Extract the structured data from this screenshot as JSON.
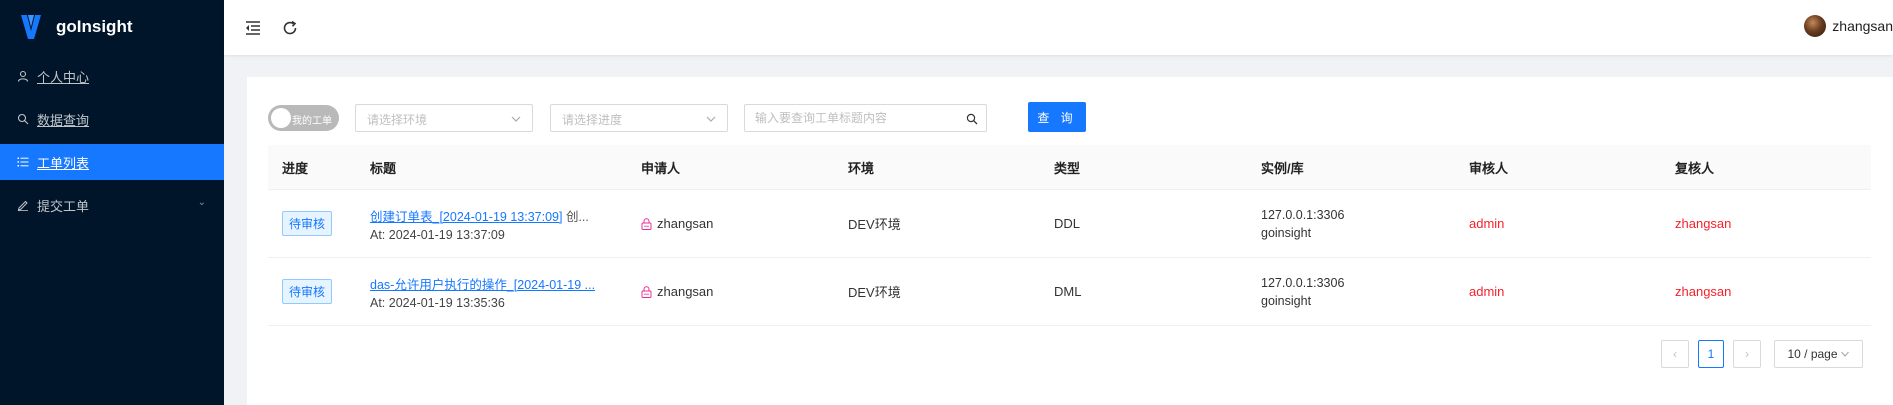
{
  "app": {
    "name": "goInsight",
    "brand_color": "#1677ff",
    "sidebar_bg": "#001529"
  },
  "sidebar": {
    "items": [
      {
        "label": "个人中心",
        "icon": "user-icon"
      },
      {
        "label": "数据查询",
        "icon": "search-icon"
      },
      {
        "label": "工单列表",
        "icon": "list-icon",
        "active": true
      },
      {
        "label": "提交工单",
        "icon": "edit-icon"
      }
    ]
  },
  "header": {
    "username": "zhangsan"
  },
  "filters": {
    "toggle_label": "我的工单",
    "env_placeholder": "请选择环境",
    "progress_placeholder": "请选择进度",
    "search_placeholder": "输入要查询工单标题内容",
    "query_button": "查 询"
  },
  "table": {
    "columns": [
      "进度",
      "标题",
      "申请人",
      "环境",
      "类型",
      "实例/库",
      "审核人",
      "复核人"
    ],
    "rows": [
      {
        "progress": "待审核",
        "title_link": "创建订单表_[2024-01-19 13:37:09]",
        "title_rest": " 创...",
        "at": "At: 2024-01-19 13:37:09",
        "applicant": "zhangsan",
        "env": "DEV环境",
        "type": "DDL",
        "instance": "127.0.0.1:3306",
        "db": "goinsight",
        "auditor": "admin",
        "reviewer": "zhangsan"
      },
      {
        "progress": "待审核",
        "title_link": "das-允许用户执行的操作_[2024-01-19 ...",
        "title_rest": "",
        "at": "At: 2024-01-19 13:35:36",
        "applicant": "zhangsan",
        "env": "DEV环境",
        "type": "DML",
        "instance": "127.0.0.1:3306",
        "db": "goinsight",
        "auditor": "admin",
        "reviewer": "zhangsan"
      }
    ]
  },
  "pagination": {
    "current_page": "1",
    "page_size": "10 / page"
  }
}
